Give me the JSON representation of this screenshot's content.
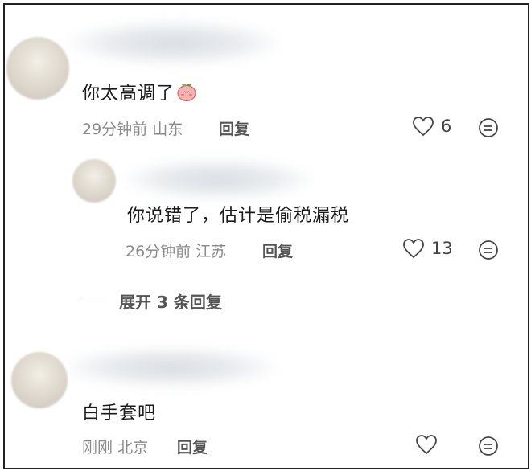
{
  "comments": [
    {
      "text": "你太高调了",
      "time": "29分钟前",
      "location": "山东",
      "reply_label": "回复",
      "likes": "6",
      "emoji_icon": "peach-blush-emoji"
    },
    {
      "text": "你说错了，估计是偷税漏税",
      "time": "26分钟前",
      "location": "江苏",
      "reply_label": "回复",
      "likes": "13"
    },
    {
      "text": "白手套吧",
      "time": "刚刚",
      "location": "北京",
      "reply_label": "回复",
      "likes": ""
    }
  ],
  "expand_replies": "展开 3 条回复",
  "colors": {
    "text": "#1a1a1a",
    "meta": "#8a8a8a",
    "icon": "#444444"
  }
}
